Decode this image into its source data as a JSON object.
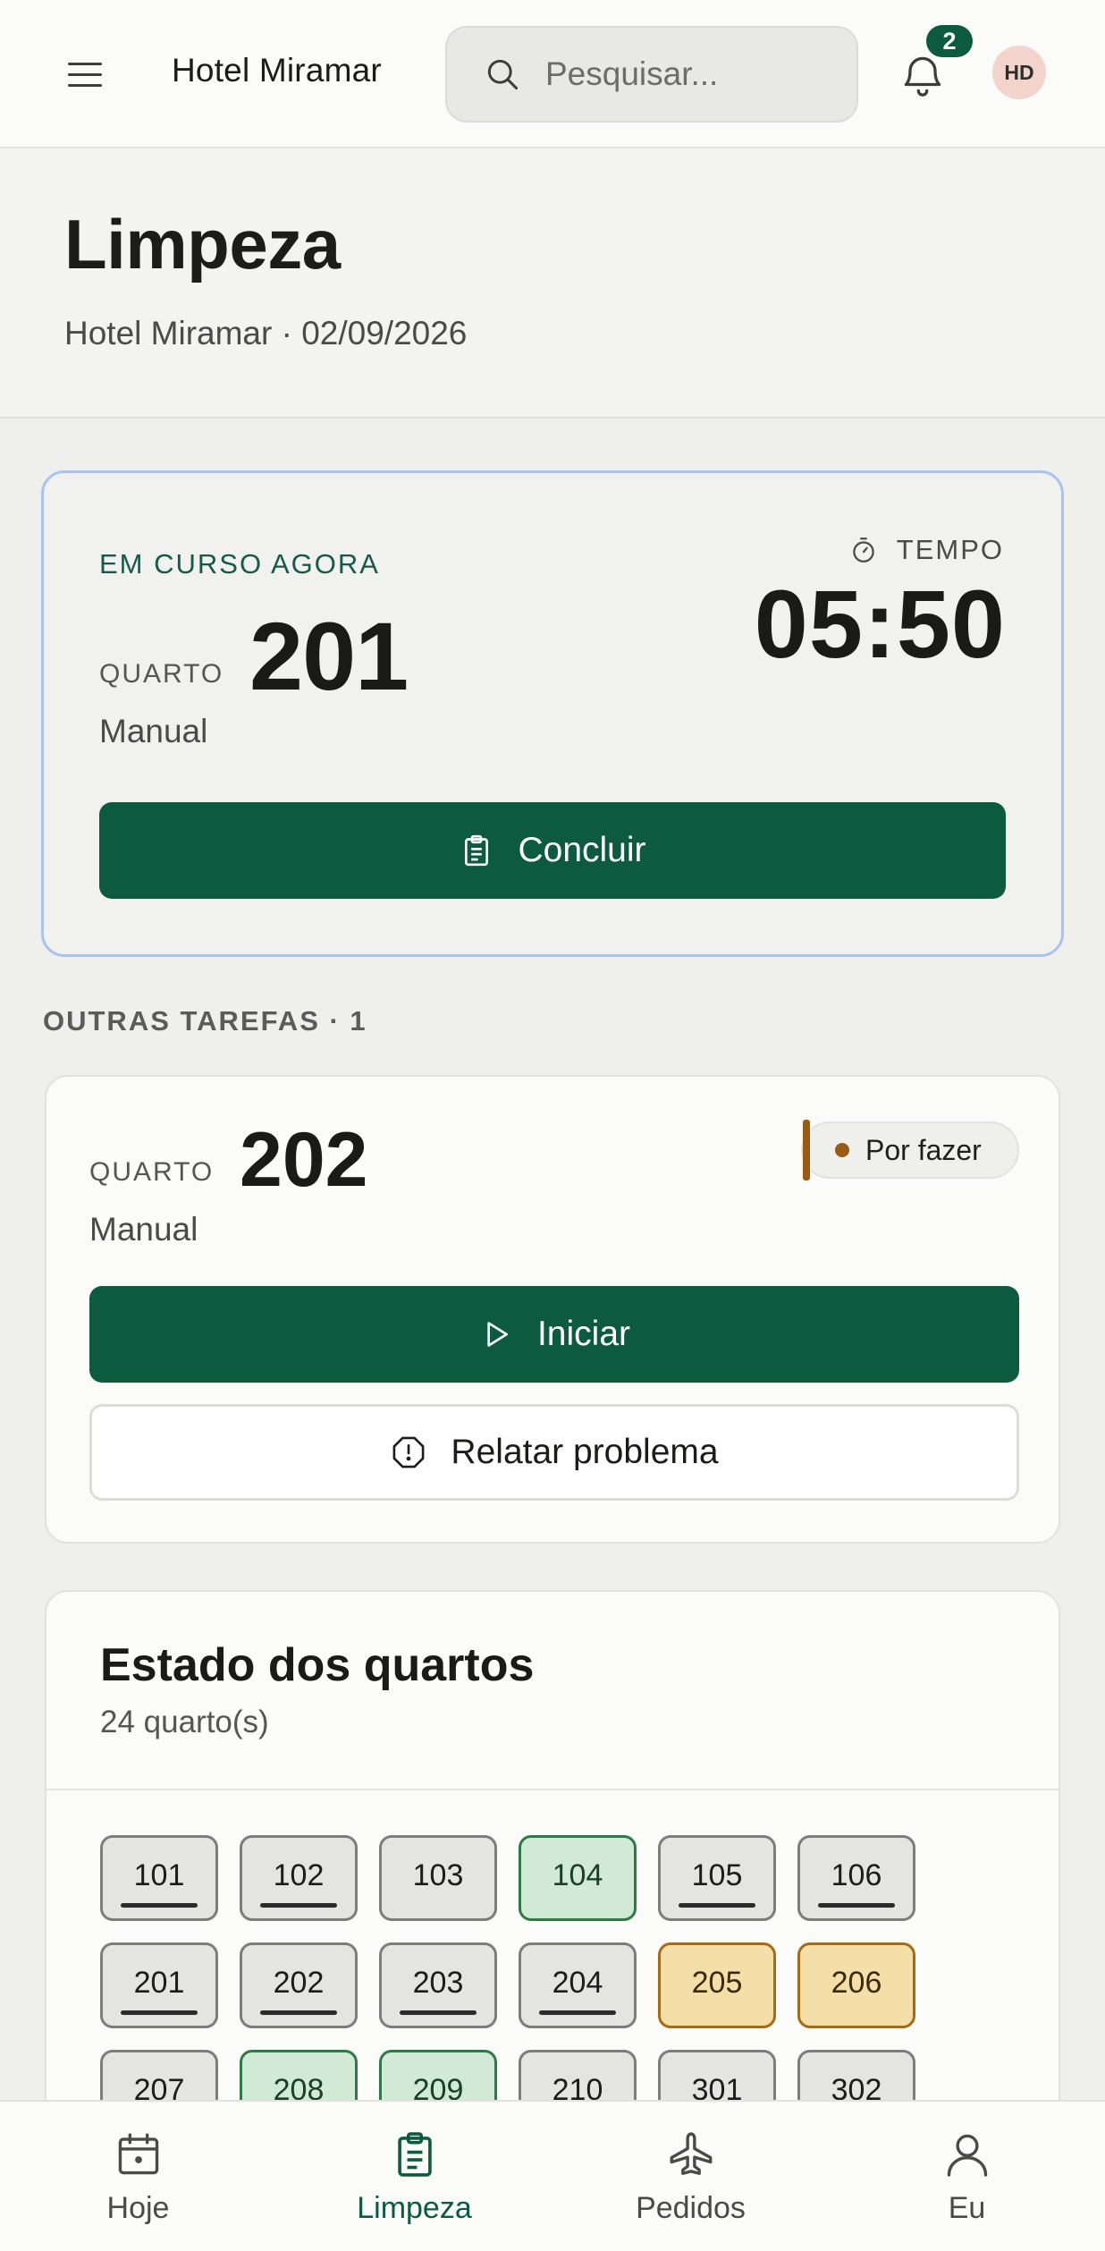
{
  "topbar": {
    "menu_icon": "hamburger-menu-icon",
    "app_title": "Hotel Miramar",
    "search_placeholder": "Pesquisar...",
    "notifications_count": "2",
    "avatar_initials": "HD"
  },
  "header": {
    "title": "Limpeza",
    "subtitle": "Hotel Miramar · 02/09/2026"
  },
  "current_task": {
    "eyebrow": "EM CURSO AGORA",
    "room_label": "QUARTO",
    "room_number": "201",
    "room_type": "Manual",
    "timer_label": "TEMPO",
    "timer_value": "05:50",
    "action_label": "Concluir"
  },
  "other_tasks": {
    "section_label": "OUTRAS TAREFAS · 1",
    "items": [
      {
        "room_label": "QUARTO",
        "room_number": "202",
        "room_type": "Manual",
        "status": "Por fazer",
        "start_label": "Iniciar",
        "report_label": "Relatar problema"
      }
    ]
  },
  "rooms_status": {
    "title": "Estado dos quartos",
    "count_label": "24 quarto(s)",
    "rooms": [
      {
        "number": "101",
        "state": "neutral",
        "underline": true
      },
      {
        "number": "102",
        "state": "neutral",
        "underline": true
      },
      {
        "number": "103",
        "state": "neutral",
        "underline": false
      },
      {
        "number": "104",
        "state": "clean",
        "underline": false
      },
      {
        "number": "105",
        "state": "neutral",
        "underline": true
      },
      {
        "number": "106",
        "state": "neutral",
        "underline": true
      },
      {
        "number": "201",
        "state": "neutral",
        "underline": true
      },
      {
        "number": "202",
        "state": "neutral",
        "underline": true
      },
      {
        "number": "203",
        "state": "neutral",
        "underline": true
      },
      {
        "number": "204",
        "state": "neutral",
        "underline": true
      },
      {
        "number": "205",
        "state": "pending",
        "underline": false
      },
      {
        "number": "206",
        "state": "pending",
        "underline": false
      },
      {
        "number": "207",
        "state": "neutral",
        "underline": false
      },
      {
        "number": "208",
        "state": "clean",
        "underline": false
      },
      {
        "number": "209",
        "state": "clean",
        "underline": false
      },
      {
        "number": "210",
        "state": "neutral",
        "underline": false
      },
      {
        "number": "301",
        "state": "neutral",
        "underline": false
      },
      {
        "number": "302",
        "state": "neutral",
        "underline": false
      }
    ]
  },
  "bottom_nav": {
    "items": [
      {
        "label": "Hoje",
        "icon": "calendar-icon",
        "active": false
      },
      {
        "label": "Limpeza",
        "icon": "clipboard-icon",
        "active": true
      },
      {
        "label": "Pedidos",
        "icon": "airplane-icon",
        "active": false
      },
      {
        "label": "Eu",
        "icon": "user-icon",
        "active": false
      }
    ]
  },
  "colors": {
    "primary": "#0c5a40",
    "pending": "#9a5a12",
    "clean_bg": "#d0ead6",
    "pending_bg": "#f4dfa8",
    "active_border": "#a9c3ef"
  }
}
